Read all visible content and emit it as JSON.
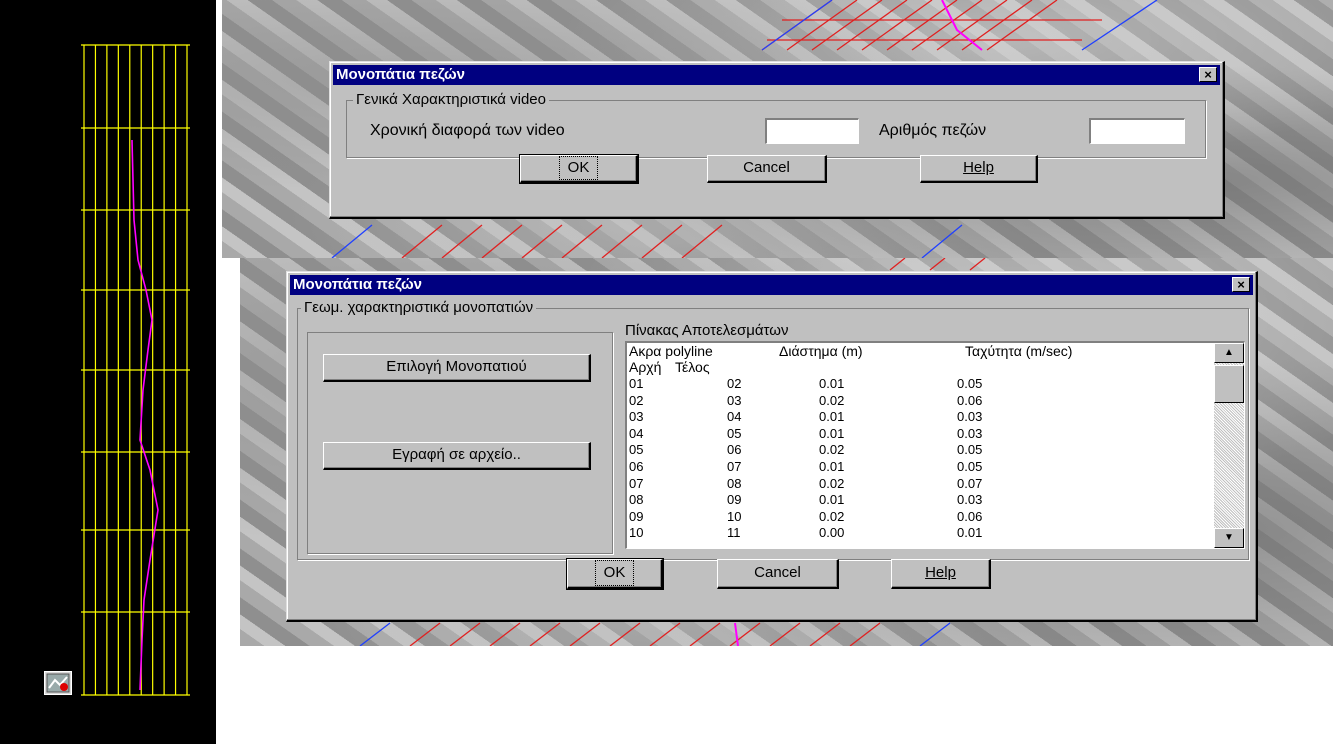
{
  "dialog_top": {
    "title": "Μονοπάτια πεζών",
    "close": "×",
    "group_label": "Γενικά Χαρακτηριστικά video",
    "time_diff_label": "Χρονική διαφορά των video",
    "time_diff_value": "",
    "pedestrians_label": "Αριθμός πεζών",
    "pedestrians_value": "",
    "ok": "OK",
    "cancel": "Cancel",
    "help": "Help"
  },
  "dialog_bottom": {
    "title": "Μονοπάτια πεζών",
    "close": "×",
    "group_label": "Γεωμ. χαρακτηριστικά μονοπατιών",
    "select_path_button": "Επιλογή Μονοπατιού",
    "write_file_button": "Εγραφή σε αρχείο..",
    "results_title": "Πίνακας Αποτελεσμάτων",
    "header": {
      "ends": "Ακρα polyline",
      "interval": "Διάστημα (m)",
      "speed": "Ταχύτητα (m/sec)",
      "start": "Αρχή",
      "end": "Τέλος"
    },
    "rows": [
      {
        "start": "01",
        "end": "02",
        "interval": "0.01",
        "speed": "0.05"
      },
      {
        "start": "02",
        "end": "03",
        "interval": "0.02",
        "speed": "0.06"
      },
      {
        "start": "03",
        "end": "04",
        "interval": "0.01",
        "speed": "0.03"
      },
      {
        "start": "04",
        "end": "05",
        "interval": "0.01",
        "speed": "0.03"
      },
      {
        "start": "05",
        "end": "06",
        "interval": "0.02",
        "speed": "0.05"
      },
      {
        "start": "06",
        "end": "07",
        "interval": "0.01",
        "speed": "0.05"
      },
      {
        "start": "07",
        "end": "08",
        "interval": "0.02",
        "speed": "0.07"
      },
      {
        "start": "08",
        "end": "09",
        "interval": "0.01",
        "speed": "0.03"
      },
      {
        "start": "09",
        "end": "10",
        "interval": "0.02",
        "speed": "0.06"
      },
      {
        "start": "10",
        "end": "11",
        "interval": "0.00",
        "speed": "0.01"
      }
    ],
    "scroll_up": "▲",
    "scroll_down": "▼",
    "ok": "OK",
    "cancel": "Cancel",
    "help": "Help"
  },
  "colors": {
    "grid": "#ffff00",
    "path": "#ff00ff",
    "titlebar": "#000080",
    "dialog": "#c0c0c0"
  }
}
